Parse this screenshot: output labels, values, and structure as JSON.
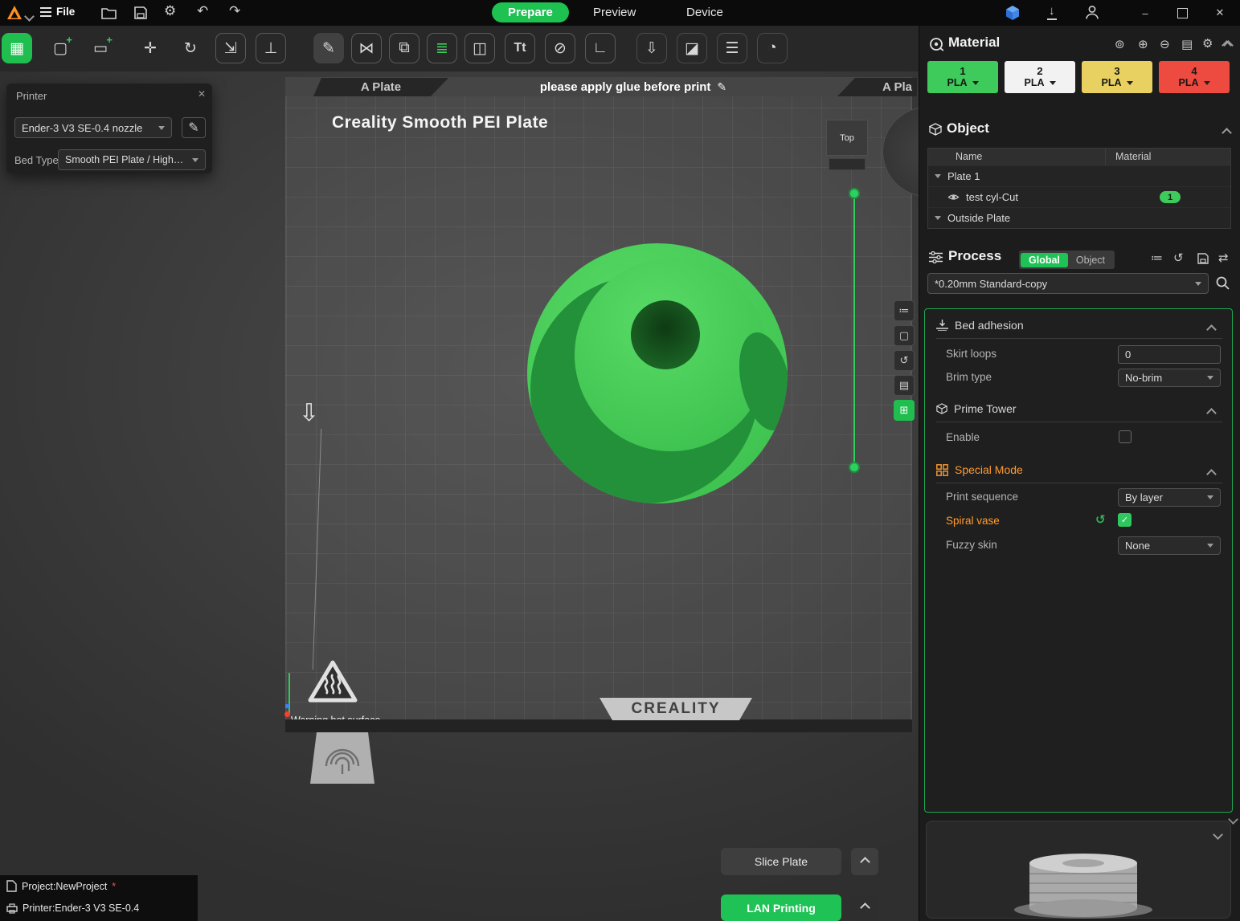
{
  "titlebar": {
    "file_label": "File",
    "tabs": [
      {
        "label": "Prepare"
      },
      {
        "label": "Preview"
      },
      {
        "label": "Device"
      }
    ]
  },
  "icons": {
    "plate_view": "▦",
    "add_model": "▢",
    "add_plate": "▭",
    "plus": "+",
    "move": "✛",
    "rotate": "↻",
    "scale": "⇲",
    "lay_flat": "⊥",
    "pen": "✎",
    "mirror": "⋈",
    "clone": "⧉",
    "layers": "≣",
    "split": "◫",
    "text": "Tt",
    "paint": "⊘",
    "measure": "∟",
    "support": "⇩",
    "cut": "◪",
    "queue": "☰",
    "calibrate": "◔",
    "undo": "↶",
    "redo": "↷",
    "gear": "⚙",
    "close": "✕",
    "minimize": "–",
    "download": "↓",
    "add_circle": "⊕",
    "remove_circle": "⊖",
    "sheet": "▤",
    "spool": "⊚",
    "history": "↺",
    "sync": "⇄",
    "list": "≔",
    "select_box": "▢",
    "reset_view": "↺",
    "grid": "⊞",
    "check": "✓",
    "arrow_down": "⇩"
  },
  "printer_panel": {
    "title": "Printer",
    "printer_value": "Ender-3 V3 SE-0.4 nozzle",
    "bed_type_label": "Bed Type:",
    "bed_type_value": "Smooth PEI Plate / High…"
  },
  "viewport": {
    "plate_tab_left": "A Plate",
    "plate_tab_right": "A Pla",
    "glue_notice": "please apply glue before print",
    "plate_title": "Creality Smooth PEI Plate",
    "view_cube_top_label": "Top",
    "warning_label": "Warning hot surface",
    "brand_label": "CREALITY"
  },
  "material_panel": {
    "title": "Material",
    "slots": [
      {
        "number": "1",
        "type": "PLA",
        "color": "#3ecb5b"
      },
      {
        "number": "2",
        "type": "PLA",
        "color": "#f2f2f2"
      },
      {
        "number": "3",
        "type": "PLA",
        "color": "#e8d160"
      },
      {
        "number": "4",
        "type": "PLA",
        "color": "#ee4b40"
      }
    ]
  },
  "object_panel": {
    "title": "Object",
    "columns": {
      "name": "Name",
      "material": "Material"
    },
    "rows": [
      {
        "name": "Plate 1"
      },
      {
        "name": "test cyl-Cut",
        "badge": "1"
      },
      {
        "name": "Outside Plate"
      }
    ]
  },
  "process_panel": {
    "title": "Process",
    "scope_global": "Global",
    "scope_object": "Object",
    "preset": "*0.20mm Standard-copy"
  },
  "settings": {
    "bed_adhesion": {
      "title": "Bed adhesion",
      "skirt_loops_label": "Skirt loops",
      "skirt_loops_value": "0",
      "brim_type_label": "Brim type",
      "brim_type_value": "No-brim"
    },
    "prime_tower": {
      "title": "Prime Tower",
      "enable_label": "Enable"
    },
    "special_mode": {
      "title": "Special Mode",
      "print_sequence_label": "Print sequence",
      "print_sequence_value": "By layer",
      "spiral_vase_label": "Spiral vase",
      "fuzzy_skin_label": "Fuzzy skin",
      "fuzzy_skin_value": "None"
    }
  },
  "actions": {
    "slice_label": "Slice Plate",
    "print_label": "LAN Printing"
  },
  "statusbar": {
    "project_label": "Project:NewProject",
    "modified": "*",
    "printer_label": "Printer:Ender-3 V3 SE-0.4"
  },
  "colors": {
    "accent_green": "#21c45d",
    "special_orange": "#ff9b30",
    "model_green": "#45ce54"
  }
}
